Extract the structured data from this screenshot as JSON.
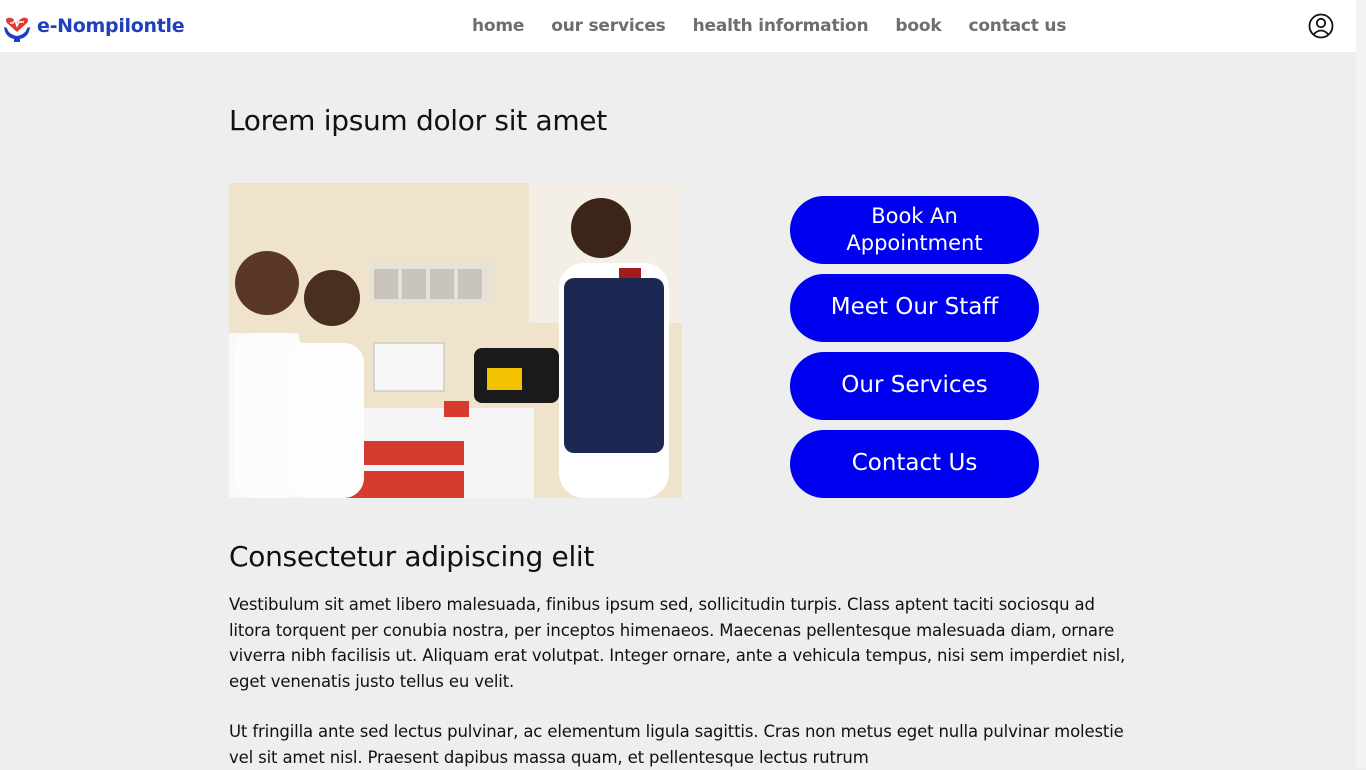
{
  "brand": {
    "name": "e-Nompilontle",
    "primary_color": "#1f3fbf",
    "accent_color": "#e53935"
  },
  "nav": {
    "items": [
      {
        "label": "home"
      },
      {
        "label": "our services"
      },
      {
        "label": "health information"
      },
      {
        "label": "book"
      },
      {
        "label": "contact us"
      }
    ],
    "user_icon": "user-circle-icon"
  },
  "main": {
    "title": "Lorem ipsum dolor sit amet",
    "image_icon": "staff-photo",
    "buttons": [
      {
        "label": "Book An Appointment"
      },
      {
        "label": "Meet Our Staff"
      },
      {
        "label": "Our Services"
      },
      {
        "label": "Contact Us"
      }
    ],
    "button_color": "#0000f0",
    "section_title": "Consectetur adipiscing elit",
    "paragraphs": [
      "Vestibulum sit amet libero malesuada, finibus ipsum sed, sollicitudin turpis. Class aptent taciti sociosqu ad litora torquent per conubia nostra, per inceptos himenaeos. Maecenas pellentesque malesuada diam, ornare viverra nibh facilisis ut. Aliquam erat volutpat. Integer ornare, ante a vehicula tempus, nisi sem imperdiet nisl, eget venenatis justo tellus eu velit.",
      "Ut fringilla ante sed lectus pulvinar, ac elementum ligula sagittis. Cras non metus eget nulla pulvinar molestie vel sit amet nisl. Praesent dapibus massa quam, et pellentesque lectus rutrum"
    ]
  }
}
